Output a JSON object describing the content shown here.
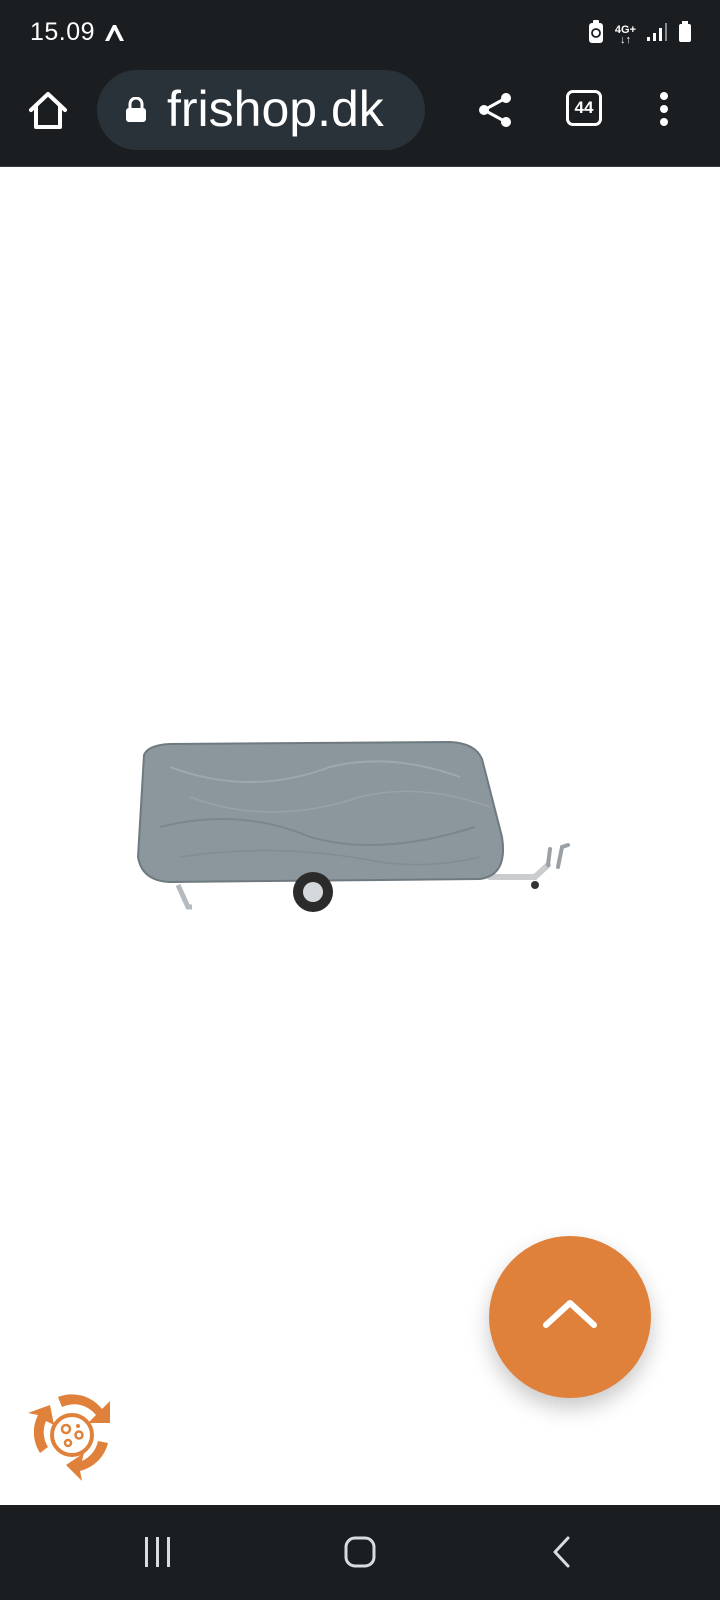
{
  "status_bar": {
    "time": "15.09",
    "network": "4G+"
  },
  "browser": {
    "url": "frishop.dk",
    "tab_count": "44"
  },
  "icons": {
    "home": "home-icon",
    "lock": "lock-icon",
    "share": "share-icon",
    "tabs": "tabs-count-icon",
    "menu": "more-vertical-icon",
    "scroll_top": "chevron-up-icon",
    "cookie": "cookie-consent-icon",
    "nav_recents": "recents-icon",
    "nav_home": "nav-home-icon",
    "nav_back": "back-icon"
  },
  "colors": {
    "accent": "#df813a",
    "bars": "#1b1e21",
    "url_pill": "#283238"
  }
}
